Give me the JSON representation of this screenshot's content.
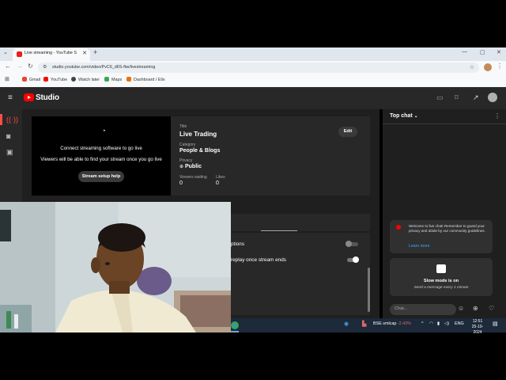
{
  "browser": {
    "tab_title": "Live streaming - YouTube Studio",
    "tab_close": "✕",
    "new_tab": "+",
    "window_controls": [
      "—",
      "▢",
      "✕"
    ],
    "url": "studio.youtube.com/video/PvC6_d6S-ftw/livestreaming",
    "bookmarks": [
      {
        "label": "Gmail",
        "color": "#ea4335"
      },
      {
        "label": "YouTube",
        "color": "#ff0000"
      },
      {
        "label": "Watch later",
        "color": "#444444"
      },
      {
        "label": "Maps",
        "color": "#34a853"
      },
      {
        "label": "Dashboard / Elix",
        "color": "#e8710a"
      }
    ]
  },
  "studio": {
    "logo_text": "Studio",
    "preview": {
      "line1": "Connect streaming software to go live",
      "line2": "Viewers will be able to find your stream once you go live",
      "setup_button": "Stream setup help"
    },
    "details": {
      "title_label": "Title",
      "title": "Live Trading",
      "category_label": "Category",
      "category": "People & Blogs",
      "privacy_label": "Privacy",
      "privacy": "Public",
      "viewers_label": "Viewers waiting",
      "viewers": "0",
      "likes_label": "Likes",
      "likes": "0",
      "edit_button": "Edit"
    },
    "settings": {
      "row1_label": "ptions",
      "row1_on": false,
      "row2_label": "replay once stream ends",
      "row2_on": true
    }
  },
  "chat": {
    "header": "Top chat",
    "welcome": "Welcome to live chat! Remember to guard your privacy and abide by our community guidelines.",
    "learn_more": "Learn more",
    "slow_mode_title": "Slow mode is on",
    "slow_mode_sub": "Send a message every 1 minute",
    "input_placeholder": "Chat..."
  },
  "taskbar": {
    "stock_name": "BSE smlcap",
    "stock_change": "-2.43%",
    "lang": "ENG",
    "time": "12:51",
    "date": "25-10-2024"
  },
  "colors": {
    "brand_red": "#ff0000",
    "link_blue": "#3ea6ff",
    "studio_bg": "#1f1f1f",
    "panel_bg": "#282828"
  }
}
